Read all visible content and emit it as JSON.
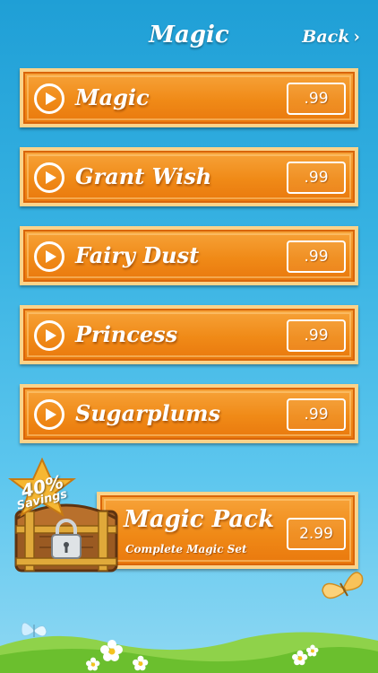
{
  "header": {
    "title": "Magic",
    "back_label": "Back"
  },
  "items": [
    {
      "name": "Magic",
      "price": ".99"
    },
    {
      "name": "Grant Wish",
      "price": ".99"
    },
    {
      "name": "Fairy Dust",
      "price": ".99"
    },
    {
      "name": "Princess",
      "price": ".99"
    },
    {
      "name": "Sugarplums",
      "price": ".99"
    }
  ],
  "pack": {
    "name": "Magic Pack",
    "subtitle": "Complete Magic Set",
    "price": "2.99",
    "badge_percent": "40%",
    "badge_text": "Savings"
  },
  "colors": {
    "sky_top": "#1f9fd6",
    "button_orange": "#f08a17",
    "button_border": "#fbd38a",
    "grass": "#7ccb3a"
  },
  "icons": {
    "play": "play-icon",
    "chest": "treasure-chest-icon",
    "lock": "padlock-icon",
    "badge": "star-badge-icon",
    "chevron": "chevron-right-icon"
  }
}
